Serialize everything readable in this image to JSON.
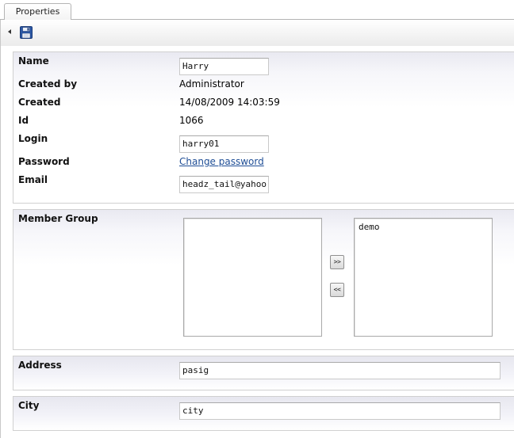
{
  "tabs": [
    {
      "label": "Properties"
    }
  ],
  "toolbar": {
    "collapse_icon": "collapse-arrow-icon",
    "save_icon": "floppy-disk-icon"
  },
  "member": {
    "name_label": "Name",
    "name_value": "Harry",
    "created_by_label": "Created by",
    "created_by_value": "Administrator",
    "created_label": "Created",
    "created_value": "14/08/2009 14:03:59",
    "id_label": "Id",
    "id_value": "1066",
    "login_label": "Login",
    "login_value": "harry01",
    "password_label": "Password",
    "password_link": "Change password",
    "email_label": "Email",
    "email_value": "headz_tail@yahoo.com"
  },
  "member_group": {
    "label": "Member Group",
    "available": [],
    "assigned": [
      "demo"
    ],
    "add_label": ">>",
    "remove_label": "<<"
  },
  "address": {
    "label": "Address",
    "value": "pasig"
  },
  "city": {
    "label": "City",
    "value": "city"
  }
}
